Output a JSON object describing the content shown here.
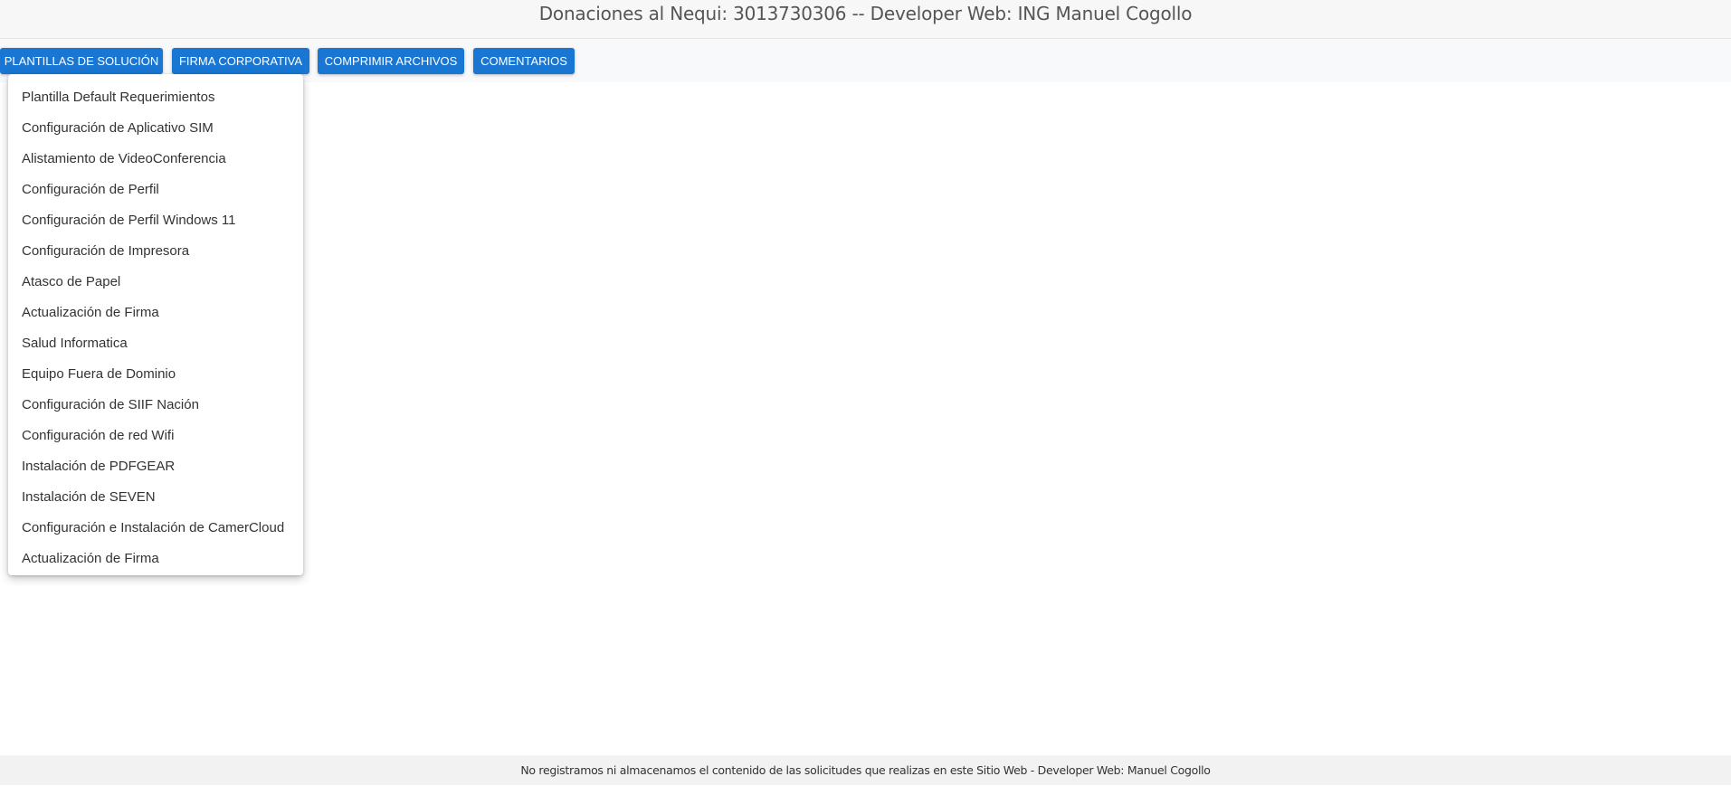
{
  "header": {
    "title": "Donaciones al Nequi: 3013730306 -- Developer Web: ING Manuel Cogollo"
  },
  "toolbar": {
    "buttons": [
      {
        "label": "PLANTILLAS DE SOLUCIÓN"
      },
      {
        "label": "FIRMA CORPORATIVA"
      },
      {
        "label": "COMPRIMIR ARCHIVOS"
      },
      {
        "label": "COMENTARIOS"
      }
    ]
  },
  "dropdown": {
    "items": [
      {
        "label": "Plantilla Default Requerimientos"
      },
      {
        "label": "Configuración de Aplicativo SIM"
      },
      {
        "label": "Alistamiento de VideoConferencia"
      },
      {
        "label": "Configuración de Perfil"
      },
      {
        "label": "Configuración de Perfil Windows 11"
      },
      {
        "label": "Configuración de Impresora"
      },
      {
        "label": "Atasco de Papel"
      },
      {
        "label": "Actualización de Firma"
      },
      {
        "label": "Salud Informatica"
      },
      {
        "label": "Equipo Fuera de Dominio"
      },
      {
        "label": "Configuración de SIIF Nación"
      },
      {
        "label": "Configuración de red Wifi"
      },
      {
        "label": "Instalación de PDFGEAR"
      },
      {
        "label": "Instalación de SEVEN"
      },
      {
        "label": "Configuración e Instalación de CamerCloud"
      },
      {
        "label": "Actualización de Firma"
      }
    ]
  },
  "footer": {
    "text": "No registramos ni almacenamos el contenido de las solicitudes que realizas en este Sitio Web - Developer Web: Manuel Cogollo"
  },
  "colors": {
    "primary_button": "#1976d2",
    "header_background": "#f7f7f7",
    "footer_background": "#f2f2f2"
  }
}
